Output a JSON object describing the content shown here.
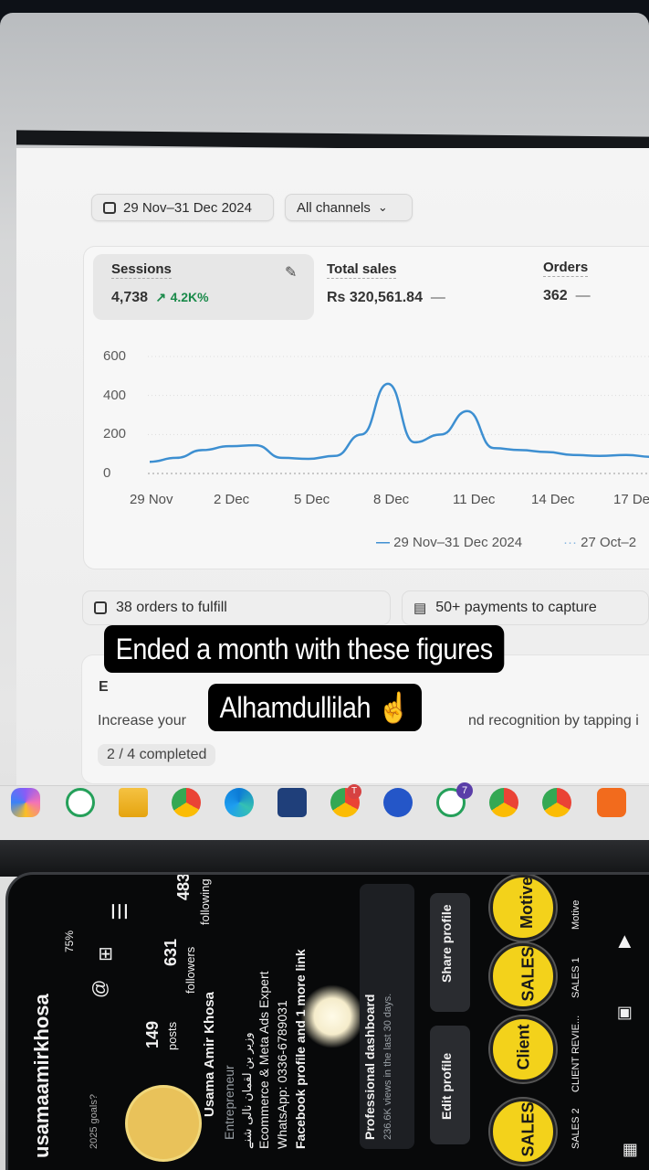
{
  "filters": {
    "date_range": "29 Nov–31 Dec 2024",
    "channels": "All channels"
  },
  "metrics": {
    "sessions": {
      "label": "Sessions",
      "value": "4,738",
      "change": "4.2K%"
    },
    "total_sales": {
      "label": "Total sales",
      "value": "Rs 320,561.84",
      "change": "—"
    },
    "orders": {
      "label": "Orders",
      "value": "362",
      "change": "—"
    }
  },
  "chart_data": {
    "type": "line",
    "x": [
      "29 Nov",
      "30 Nov",
      "1 Dec",
      "2 Dec",
      "3 Dec",
      "4 Dec",
      "5 Dec",
      "6 Dec",
      "7 Dec",
      "8 Dec",
      "9 Dec",
      "10 Dec",
      "11 Dec",
      "12 Dec",
      "13 Dec",
      "14 Dec",
      "15 Dec",
      "16 Dec",
      "17 Dec",
      "18 Dec"
    ],
    "tick_labels": [
      "29 Nov",
      "2 Dec",
      "5 Dec",
      "8 Dec",
      "11 Dec",
      "14 Dec",
      "17 De"
    ],
    "yticks": [
      "600",
      "400",
      "200",
      "0"
    ],
    "ylim": [
      0,
      600
    ],
    "series": [
      {
        "name": "29 Nov–31 Dec 2024",
        "color": "#3d8fd1",
        "values": [
          60,
          80,
          120,
          140,
          145,
          80,
          75,
          90,
          200,
          460,
          160,
          200,
          320,
          130,
          120,
          110,
          95,
          90,
          95,
          85
        ]
      }
    ],
    "legend": [
      {
        "label": "29 Nov–31 Dec 2024",
        "style": "solid"
      },
      {
        "label": "27 Oct–2",
        "style": "dotted"
      }
    ],
    "grid": true
  },
  "tasks": {
    "fulfill": "38 orders to fulfill",
    "payments": "50+ payments to capture"
  },
  "setup": {
    "heading_initial": "E",
    "body_left": "Increase your",
    "body_right": "nd recognition by tapping i",
    "progress": "2 / 4 completed"
  },
  "caption": {
    "line1": "Ended a month with these figures",
    "line2": "Alhamdullilah ☝️"
  },
  "taskbar": {
    "whatsapp_badge": "7",
    "chrome_badge": "T"
  },
  "profile": {
    "username": "usamaamirkhosa",
    "posts": "149",
    "posts_label": "posts",
    "followers": "631",
    "followers_label": "followers",
    "following": "483",
    "following_label": "following",
    "name": "Usama Amir Khosa",
    "category": "Entrepreneur",
    "bio_urdu": "وزیر بن لقمان نالی شنے",
    "bio_line1": "Ecommerce & Meta Ads Expert",
    "bio_line2": "WhatsApp: 0336-6789031",
    "bio_line3": "Facebook profile and 1 more link",
    "dashboard_title": "Professional dashboard",
    "dashboard_sub": "236.6K views in the last 30 days.",
    "edit_btn": "Edit profile",
    "share_btn": "Share profile",
    "note": "2025 goals?",
    "battery": "75%",
    "highlights": [
      {
        "title": "SALES",
        "label": "SALES 2"
      },
      {
        "title": "Client",
        "label": "CLIENT REVIE..."
      },
      {
        "title": "SALES",
        "label": "SALES 1"
      },
      {
        "title": "Motive",
        "label": "Motive"
      }
    ]
  }
}
